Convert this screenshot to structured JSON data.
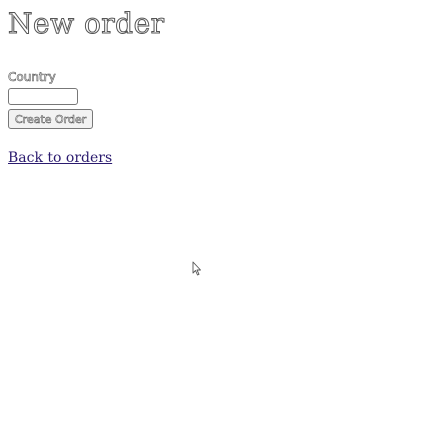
{
  "page": {
    "title": "New order"
  },
  "form": {
    "country_label": "Country",
    "country_value": "",
    "submit_label": "Create Order"
  },
  "links": {
    "back_label": "Back to orders"
  },
  "icons": {
    "cursor": "mouse-pointer-icon"
  }
}
